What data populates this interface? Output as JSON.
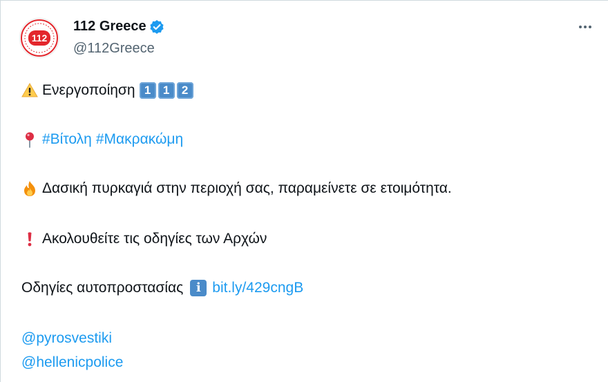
{
  "account": {
    "display_name": "112 Greece",
    "handle": "@112Greece",
    "avatar_text": "112",
    "verified": true
  },
  "tweet": {
    "line1": {
      "icon": "warning-icon",
      "text": "Ενεργοποίηση",
      "keycaps": [
        "1",
        "1",
        "2"
      ]
    },
    "line2": {
      "icon": "round-pushpin-icon",
      "hashtags": [
        "#Βίτολη",
        "#Μακρακώμη"
      ]
    },
    "line3": {
      "icon": "fire-icon",
      "text": "Δασική πυρκαγιά στην περιοχή σας, παραμείνετε σε ετοιμότητα."
    },
    "line4": {
      "icon": "exclamation-icon",
      "text": "Ακολουθείτε τις οδηγίες των Αρχών"
    },
    "line5": {
      "text": "Οδηγίες αυτοπροστασίας",
      "info_glyph": "i",
      "link": "bit.ly/429cngB"
    },
    "mentions": [
      "@pyrosvestiki",
      "@hellenicpolice"
    ]
  },
  "colors": {
    "link": "#1d9bf0",
    "verified_badge": "#1d9bf0",
    "avatar_red": "#e3262c",
    "keycap": "#4a8bc9",
    "secondary_text": "#536471"
  }
}
